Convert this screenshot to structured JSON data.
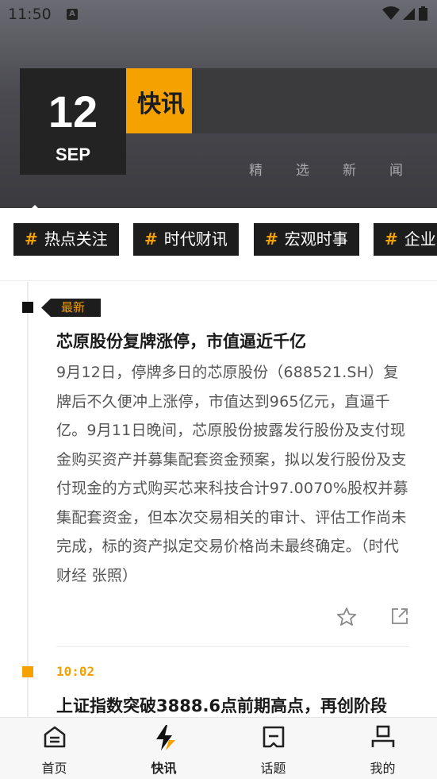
{
  "status_bar": {
    "time": "11:50",
    "notification_icon": "A"
  },
  "header": {
    "date_day": "12",
    "date_month": "SEP",
    "section_title": "快讯",
    "slogan": [
      "精",
      "选",
      "新",
      "闻"
    ]
  },
  "tags": [
    "热点关注",
    "时代财讯",
    "宏观时事",
    "企业"
  ],
  "tag_hash": "#",
  "feed": {
    "items": [
      {
        "badge": "最新",
        "title": "芯原股份复牌涨停，市值逼近千亿",
        "body": "9月12日，停牌多日的芯原股份（688521.SH）复牌后不久便冲上涨停，市值达到965亿元，直逼千亿。9月11日晚间，芯原股份披露发行股份及支付现金购买资产并募集配套资金预案，拟以发行股份及支付现金的方式购买芯来科技合计97.0070%股权并募集配套资金，但本次交易相关的审计、评估工作尚未完成，标的资产拟定交易价格尚未最终确定。（时代财经 张照）"
      },
      {
        "time": "10:02",
        "title": "上证指数突破3888.6点前期高点，再创阶段"
      }
    ]
  },
  "bottom_nav": [
    {
      "label": "首页",
      "icon": "home-icon"
    },
    {
      "label": "快讯",
      "icon": "lightning-icon",
      "active": true
    },
    {
      "label": "话题",
      "icon": "topic-icon"
    },
    {
      "label": "我的",
      "icon": "profile-icon"
    }
  ],
  "colors": {
    "accent": "#f5a100",
    "dark": "#1d1d1d"
  }
}
